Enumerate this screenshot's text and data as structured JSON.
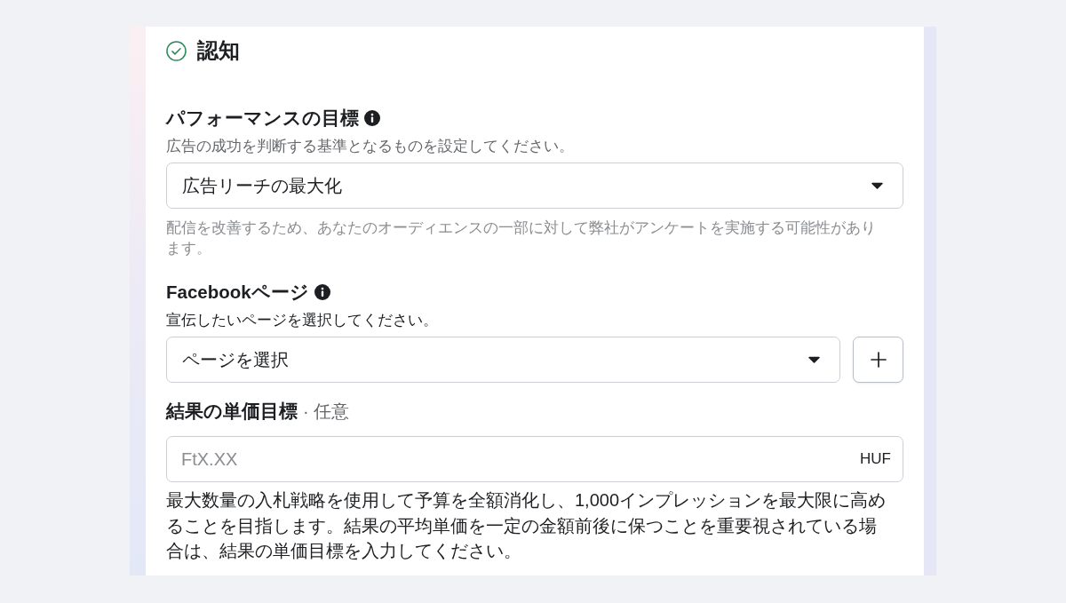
{
  "section": {
    "title": "認知",
    "completed": true
  },
  "fields": [
    {
      "kind": "select",
      "label": "パフォーマンスの目標",
      "info": true,
      "description": {
        "text": "広告の成功を判断する基準となるものを設定してください。",
        "muted": true
      },
      "value": "広告リーチの最大化",
      "add_button": false,
      "help": {
        "text": "配信を改善するため、あなたのオーディエンスの一部に対して弊社がアンケートを実施する可能性があります。",
        "muted": true
      }
    },
    {
      "kind": "select",
      "label": "Facebookページ",
      "info": true,
      "description": {
        "text": "宣伝したいページを選択してください。",
        "muted": false
      },
      "value": "ページを選択",
      "add_button": true
    },
    {
      "kind": "input",
      "label": "結果の単価目標",
      "optional_note": "· 任意",
      "info": false,
      "placeholder": "FtX.XX",
      "suffix": "HUF",
      "help": {
        "text": "最大数量の入札戦略を使用して予算を全額消化し、1,000インプレッションを最大限に高めることを目指します。結果の平均単価を一定の金額前後に保つことを重要視されている場合は、結果の単価目標を入力してください。",
        "muted": false
      }
    }
  ]
}
